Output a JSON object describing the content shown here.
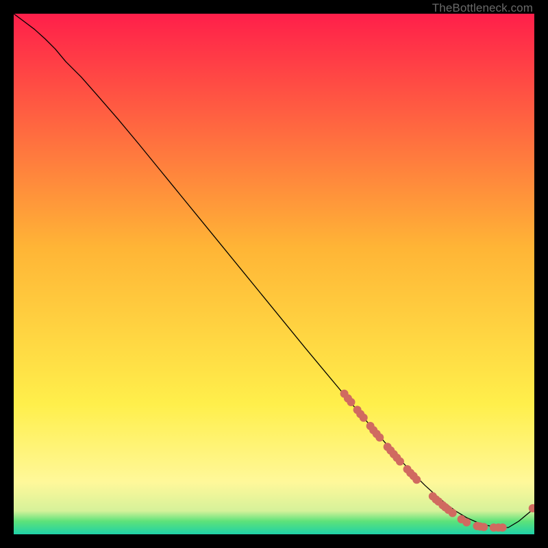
{
  "attribution": "TheBottleneck.com",
  "chart_data": {
    "type": "line",
    "title": "",
    "xlabel": "",
    "ylabel": "",
    "xlim": [
      0,
      100
    ],
    "ylim": [
      0,
      100
    ],
    "grid": false,
    "legend": false,
    "colors": {
      "line": "#000000",
      "marker": "#d06a60"
    },
    "gradient_bg": {
      "top": "#ff1f4a",
      "mid_upper": "#ffb536",
      "mid_lower": "#ffef4b",
      "near_bottom": "#5de27a",
      "bottom": "#1fd2a8"
    },
    "series": [
      {
        "name": "curve",
        "x": [
          0,
          2,
          4,
          6,
          8,
          10,
          13,
          16,
          20,
          24,
          28,
          32,
          36,
          40,
          44,
          48,
          52,
          56,
          60,
          63,
          66,
          69,
          71,
          73,
          75,
          77,
          79,
          81,
          83,
          85,
          87,
          89,
          91,
          93,
          95,
          97,
          100
        ],
        "y": [
          100,
          98.5,
          97,
          95.2,
          93.2,
          90.8,
          87.8,
          84.4,
          79.8,
          75,
          70.1,
          65.2,
          60.3,
          55.4,
          50.5,
          45.6,
          40.7,
          35.8,
          31,
          27.4,
          23.8,
          20.3,
          18,
          15.7,
          13.5,
          11.4,
          9.4,
          7.6,
          5.9,
          4.4,
          3.2,
          2.3,
          1.7,
          1.3,
          1.3,
          2.5,
          5.0
        ]
      }
    ],
    "markers": [
      {
        "x": 63.5,
        "y": 27
      },
      {
        "x": 64.2,
        "y": 26.1
      },
      {
        "x": 64.8,
        "y": 25.4
      },
      {
        "x": 66.0,
        "y": 23.9
      },
      {
        "x": 66.6,
        "y": 23.1
      },
      {
        "x": 67.2,
        "y": 22.4
      },
      {
        "x": 68.5,
        "y": 20.8
      },
      {
        "x": 69.1,
        "y": 20.0
      },
      {
        "x": 69.7,
        "y": 19.3
      },
      {
        "x": 70.3,
        "y": 18.6
      },
      {
        "x": 71.8,
        "y": 16.8
      },
      {
        "x": 72.4,
        "y": 16.1
      },
      {
        "x": 73.0,
        "y": 15.4
      },
      {
        "x": 73.6,
        "y": 14.7
      },
      {
        "x": 74.2,
        "y": 14.0
      },
      {
        "x": 75.6,
        "y": 12.5
      },
      {
        "x": 76.2,
        "y": 11.8
      },
      {
        "x": 76.8,
        "y": 11.2
      },
      {
        "x": 77.4,
        "y": 10.5
      },
      {
        "x": 80.5,
        "y": 7.3
      },
      {
        "x": 81.1,
        "y": 6.7
      },
      {
        "x": 81.6,
        "y": 6.3
      },
      {
        "x": 82.4,
        "y": 5.6
      },
      {
        "x": 82.9,
        "y": 5.2
      },
      {
        "x": 83.5,
        "y": 4.7
      },
      {
        "x": 84.3,
        "y": 4.1
      },
      {
        "x": 86.0,
        "y": 2.9
      },
      {
        "x": 87.0,
        "y": 2.3
      },
      {
        "x": 89.0,
        "y": 1.6
      },
      {
        "x": 89.6,
        "y": 1.5
      },
      {
        "x": 90.3,
        "y": 1.4
      },
      {
        "x": 92.2,
        "y": 1.3
      },
      {
        "x": 93.1,
        "y": 1.3
      },
      {
        "x": 93.9,
        "y": 1.3
      },
      {
        "x": 99.7,
        "y": 5.0
      }
    ],
    "marker_radius": 6
  }
}
